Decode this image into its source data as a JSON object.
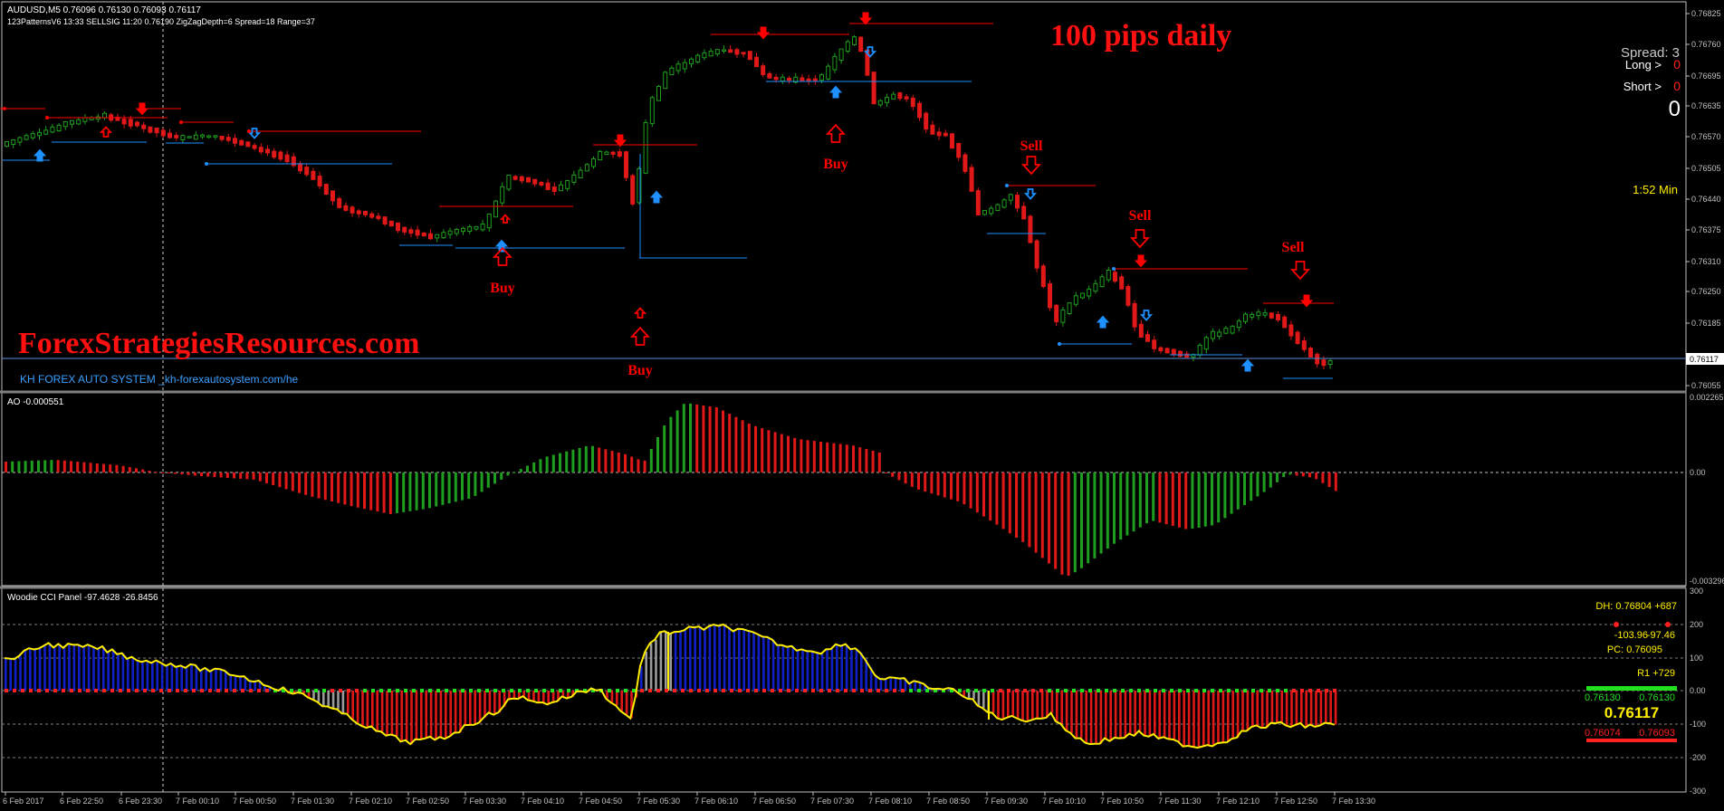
{
  "colors": {
    "bg": "#000000",
    "up_candle": "#1f9d1f",
    "down_candle": "#e01818",
    "signal_red": "#ff0000",
    "signal_blue": "#1e90ff",
    "histo_blue": "#1020c8",
    "histo_red": "#e01818",
    "histo_gray": "#9a9a9a",
    "cci_line": "#ffee00",
    "axis": "#c0c0c0"
  },
  "main": {
    "info_line1": "AUDUSD,M5  0.76096 0.76130 0.76093 0.76117",
    "info_line2": "123PatternsV6  13:33  SELLSIG  11:20  0.76190  ZigZagDepth=6  Spread=18  Range=37",
    "headline": "100 pips daily",
    "watermark": "ForexStrategiesResources.com",
    "system_label": "KH FOREX AUTO SYSTEM _kh-forexautosystem.com/he",
    "panel": {
      "spread": "Spread: 3",
      "long_label": "Long >",
      "long_value": "0",
      "short_label": "Short >",
      "short_value": "0",
      "total": "0",
      "timer": "1:52 Min"
    },
    "price_labels": [
      "0.76825",
      "0.76760",
      "0.76695",
      "0.76635",
      "0.76570",
      "0.76505",
      "0.76440",
      "0.76375",
      "0.76310",
      "0.76250",
      "0.76185",
      "0.76055"
    ],
    "current_price": "0.76117",
    "signals": [
      {
        "label": "Buy"
      },
      {
        "label": "Buy"
      },
      {
        "label": "Buy"
      },
      {
        "label": "Sell"
      },
      {
        "label": "Sell"
      },
      {
        "label": "Sell"
      }
    ]
  },
  "ao": {
    "title": "AO -0.000551",
    "axis_labels": [
      "0.002265",
      "0.00",
      "-0.003296"
    ]
  },
  "cci": {
    "title": "Woodie CCI Panel -97.4628 -26.8456",
    "axis_labels": [
      "300",
      "200",
      "100",
      "0.00",
      "-100",
      "-200",
      "-300"
    ],
    "dh": "DH: 0.76804 +687",
    "vals_left": "-103.96",
    "vals_right": "-97.46",
    "pc": "PC: 0.76095",
    "r1": "R1 +729",
    "hi_left": "0.76130",
    "hi_right": "0.76130",
    "price": "0.76117",
    "lo_left": "0.76074",
    "lo_right": "0.76093"
  },
  "time_labels": [
    "6 Feb 2017",
    "6 Feb 22:50",
    "6 Feb 23:30",
    "7 Feb 00:10",
    "7 Feb 00:50",
    "7 Feb 01:30",
    "7 Feb 02:10",
    "7 Feb 02:50",
    "7 Feb 03:30",
    "7 Feb 04:10",
    "7 Feb 04:50",
    "7 Feb 05:30",
    "7 Feb 06:10",
    "7 Feb 06:50",
    "7 Feb 07:30",
    "7 Feb 08:10",
    "7 Feb 08:50",
    "7 Feb 09:30",
    "7 Feb 10:10",
    "7 Feb 10:50",
    "7 Feb 11:30",
    "7 Feb 12:10",
    "7 Feb 12:50",
    "7 Feb 13:30"
  ]
}
